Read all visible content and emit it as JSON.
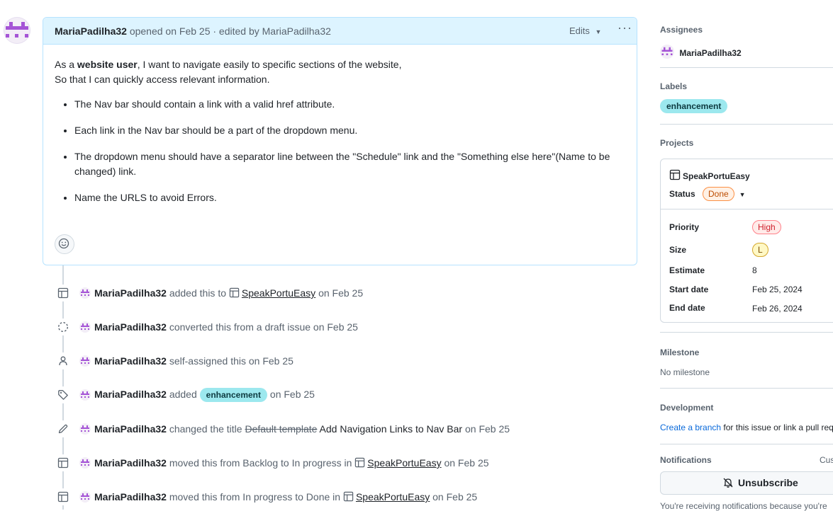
{
  "issue": {
    "author": "MariaPadilha32",
    "opened_text": "opened on Feb 25 · edited by MariaPadilha32",
    "edits_label": "Edits",
    "more_label": "···",
    "story_prefix": "As a ",
    "story_role": "website user",
    "story_rest": ", I want to navigate easily to specific sections of the website,",
    "story_line2": "So that I can quickly access relevant information.",
    "requirements": [
      "The Nav bar should contain a link with a valid href attribute.",
      "Each link in the Nav bar should be a part of the dropdown menu.",
      "The dropdown menu should have a separator line between the \"Schedule\" link and the \"Something else here\"(Name to be changed) link.",
      "Name the URLS to avoid Errors."
    ]
  },
  "timeline": {
    "e1": {
      "user": "MariaPadilha32",
      "action": "added this to",
      "project": "SpeakPortuEasy",
      "date": "on Feb 25"
    },
    "e2": {
      "user": "MariaPadilha32",
      "action": "converted this from a draft issue on Feb 25"
    },
    "e3": {
      "user": "MariaPadilha32",
      "action": "self-assigned this on Feb 25"
    },
    "e4": {
      "user": "MariaPadilha32",
      "action": "added",
      "label": "enhancement",
      "date": "on Feb 25"
    },
    "e5": {
      "user": "MariaPadilha32",
      "action": "changed the title",
      "old_title": "Default template",
      "new_title": "Add Navigation Links to Nav Bar",
      "date": "on Feb 25"
    },
    "e6": {
      "user": "MariaPadilha32",
      "action": "moved this from Backlog to In progress in",
      "project": "SpeakPortuEasy",
      "date": "on Feb 25"
    },
    "e7": {
      "user": "MariaPadilha32",
      "action": "moved this from In progress to Done in",
      "project": "SpeakPortuEasy",
      "date": "on Feb 25"
    }
  },
  "sidebar": {
    "assignees_heading": "Assignees",
    "assignee": "MariaPadilha32",
    "labels_heading": "Labels",
    "label": "enhancement",
    "projects_heading": "Projects",
    "project": {
      "name": "SpeakPortuEasy",
      "status_label": "Status",
      "status_value": "Done",
      "fields": {
        "priority_label": "Priority",
        "priority_value": "High",
        "size_label": "Size",
        "size_value": "L",
        "estimate_label": "Estimate",
        "estimate_value": "8",
        "start_label": "Start date",
        "start_value": "Feb 25, 2024",
        "end_label": "End date",
        "end_value": "Feb 26, 2024"
      }
    },
    "milestone_heading": "Milestone",
    "milestone_value": "No milestone",
    "development_heading": "Development",
    "development_link": "Create a branch",
    "development_rest": " for this issue or link a pull requ",
    "notifications_heading": "Notifications",
    "notifications_customize": "Cus",
    "unsubscribe_label": "Unsubscribe",
    "notifications_note": "You're receiving notifications because you're"
  },
  "colors": {
    "label_bg": "#9ce8ee",
    "avatar_purple": "#a554d6",
    "comment_header_bg": "#ddf4ff",
    "status_done": "#bc4c00",
    "priority_high": "#cf222e",
    "size_l": "#7d4e00"
  },
  "icons": {
    "avatar": "identicon-avatar",
    "table": "table-icon",
    "draft": "dashed-circle-icon",
    "person": "person-icon",
    "tag": "tag-icon",
    "pencil": "pencil-icon",
    "smiley": "smiley-icon",
    "bell": "bell-slash-icon"
  }
}
